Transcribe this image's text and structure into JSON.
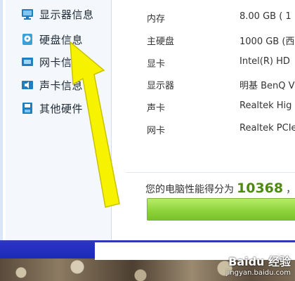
{
  "sidebar": {
    "items": [
      {
        "label": "显示器信息",
        "icon": "monitor-icon"
      },
      {
        "label": "硬盘信息",
        "icon": "disk-icon"
      },
      {
        "label": "网卡信息",
        "icon": "network-card-icon"
      },
      {
        "label": "声卡信息",
        "icon": "sound-card-icon"
      },
      {
        "label": "其他硬件",
        "icon": "other-hardware-icon"
      }
    ]
  },
  "specs": [
    {
      "key": "内存",
      "value": "8.00 GB (   1"
    },
    {
      "key": "主硬盘",
      "value": "1000 GB (西"
    },
    {
      "key": "显卡",
      "value": "Intel(R) HD"
    },
    {
      "key": "显示器",
      "value": "明基 BenQ V"
    },
    {
      "key": "声卡",
      "value": "Realtek Hig"
    },
    {
      "key": "网卡",
      "value": "Realtek PCIe"
    }
  ],
  "score": {
    "prefix": "您的电脑性能得分为",
    "value": "10368",
    "suffix": "，",
    "level": 1.0
  },
  "watermark": {
    "brand": "Baidu 经验",
    "url": "jingyan.baidu.com"
  },
  "colors": {
    "accent_green": "#4f8a10",
    "arrow_yellow": "#f6f200",
    "taskbar_blue": "#2d3ab8"
  }
}
